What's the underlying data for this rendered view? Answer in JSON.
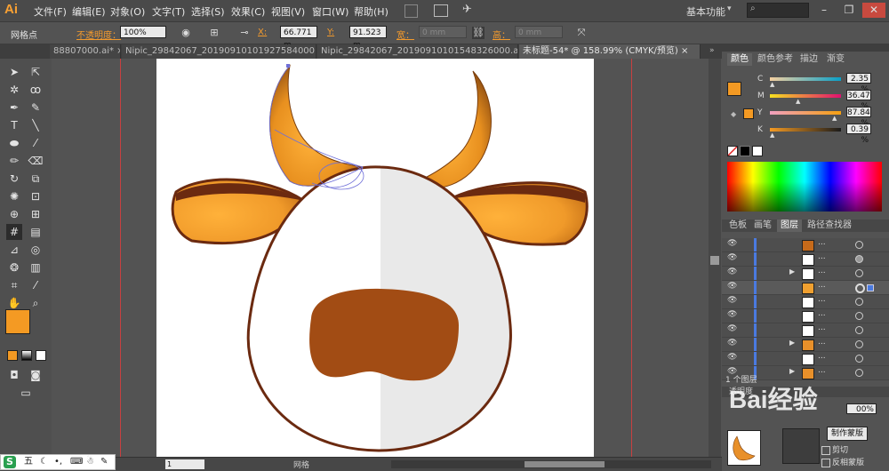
{
  "app": {
    "logo": "Ai"
  },
  "menu": [
    "文件(F)",
    "编辑(E)",
    "对象(O)",
    "文字(T)",
    "选择(S)",
    "效果(C)",
    "视图(V)",
    "窗口(W)",
    "帮助(H)"
  ],
  "workspace": "基本功能",
  "window_controls": {
    "minimize": "–",
    "restore": "❐",
    "close": "✕"
  },
  "control_bar": {
    "selection_label": "网格点",
    "opacity_label": "不透明度：",
    "opacity_value": "100%",
    "x_label": "X:",
    "x_value": "66.771 m",
    "y_label": "Y:",
    "y_value": "91.523 m",
    "w_label": "宽：",
    "w_value": "0 mm",
    "h_label": "高：",
    "h_value": "0 mm"
  },
  "tabs": [
    "88807000.ai* ×",
    "Nipic_29842067_20190910101927584000.ai* ×",
    "Nipic_29842067_20190910101548326000.ai* ×",
    "未标题-54* @ 158.99% (CMYK/预览) ×"
  ],
  "color_panel": {
    "tabs": [
      "颜色",
      "颜色参考",
      "描边",
      "渐变"
    ],
    "channels": [
      {
        "label": "C",
        "value": "2.35 %",
        "level": 0.0235
      },
      {
        "label": "M",
        "value": "36.47 %",
        "level": 0.3647
      },
      {
        "label": "Y",
        "value": "87.84 %",
        "level": 0.8784
      },
      {
        "label": "K",
        "value": "0.39 %",
        "level": 0.0039
      }
    ],
    "fill_color": "#f49a23"
  },
  "layers_panel": {
    "tabs": [
      "色板",
      "画笔",
      "图层",
      "路径查找器"
    ],
    "rows": [
      "...",
      "...",
      "...",
      "...",
      "...",
      "...",
      "...",
      "...",
      "...",
      "..."
    ],
    "footer": "1 个图层"
  },
  "lower_panel": {
    "title": "透明度",
    "opacity_value": "00%",
    "btn_mask": "制作蒙版",
    "clip_label": "剪切",
    "invert_label": "反相蒙版"
  },
  "status": {
    "zoom": "1",
    "text": "网格"
  },
  "ime": {
    "label": "五"
  },
  "watermark": "Bai经验",
  "colors": {
    "horn": "#e89a2a",
    "outline": "#6b2a10",
    "nose": "#a24c14",
    "face_shadow": "#e9e9e9"
  }
}
